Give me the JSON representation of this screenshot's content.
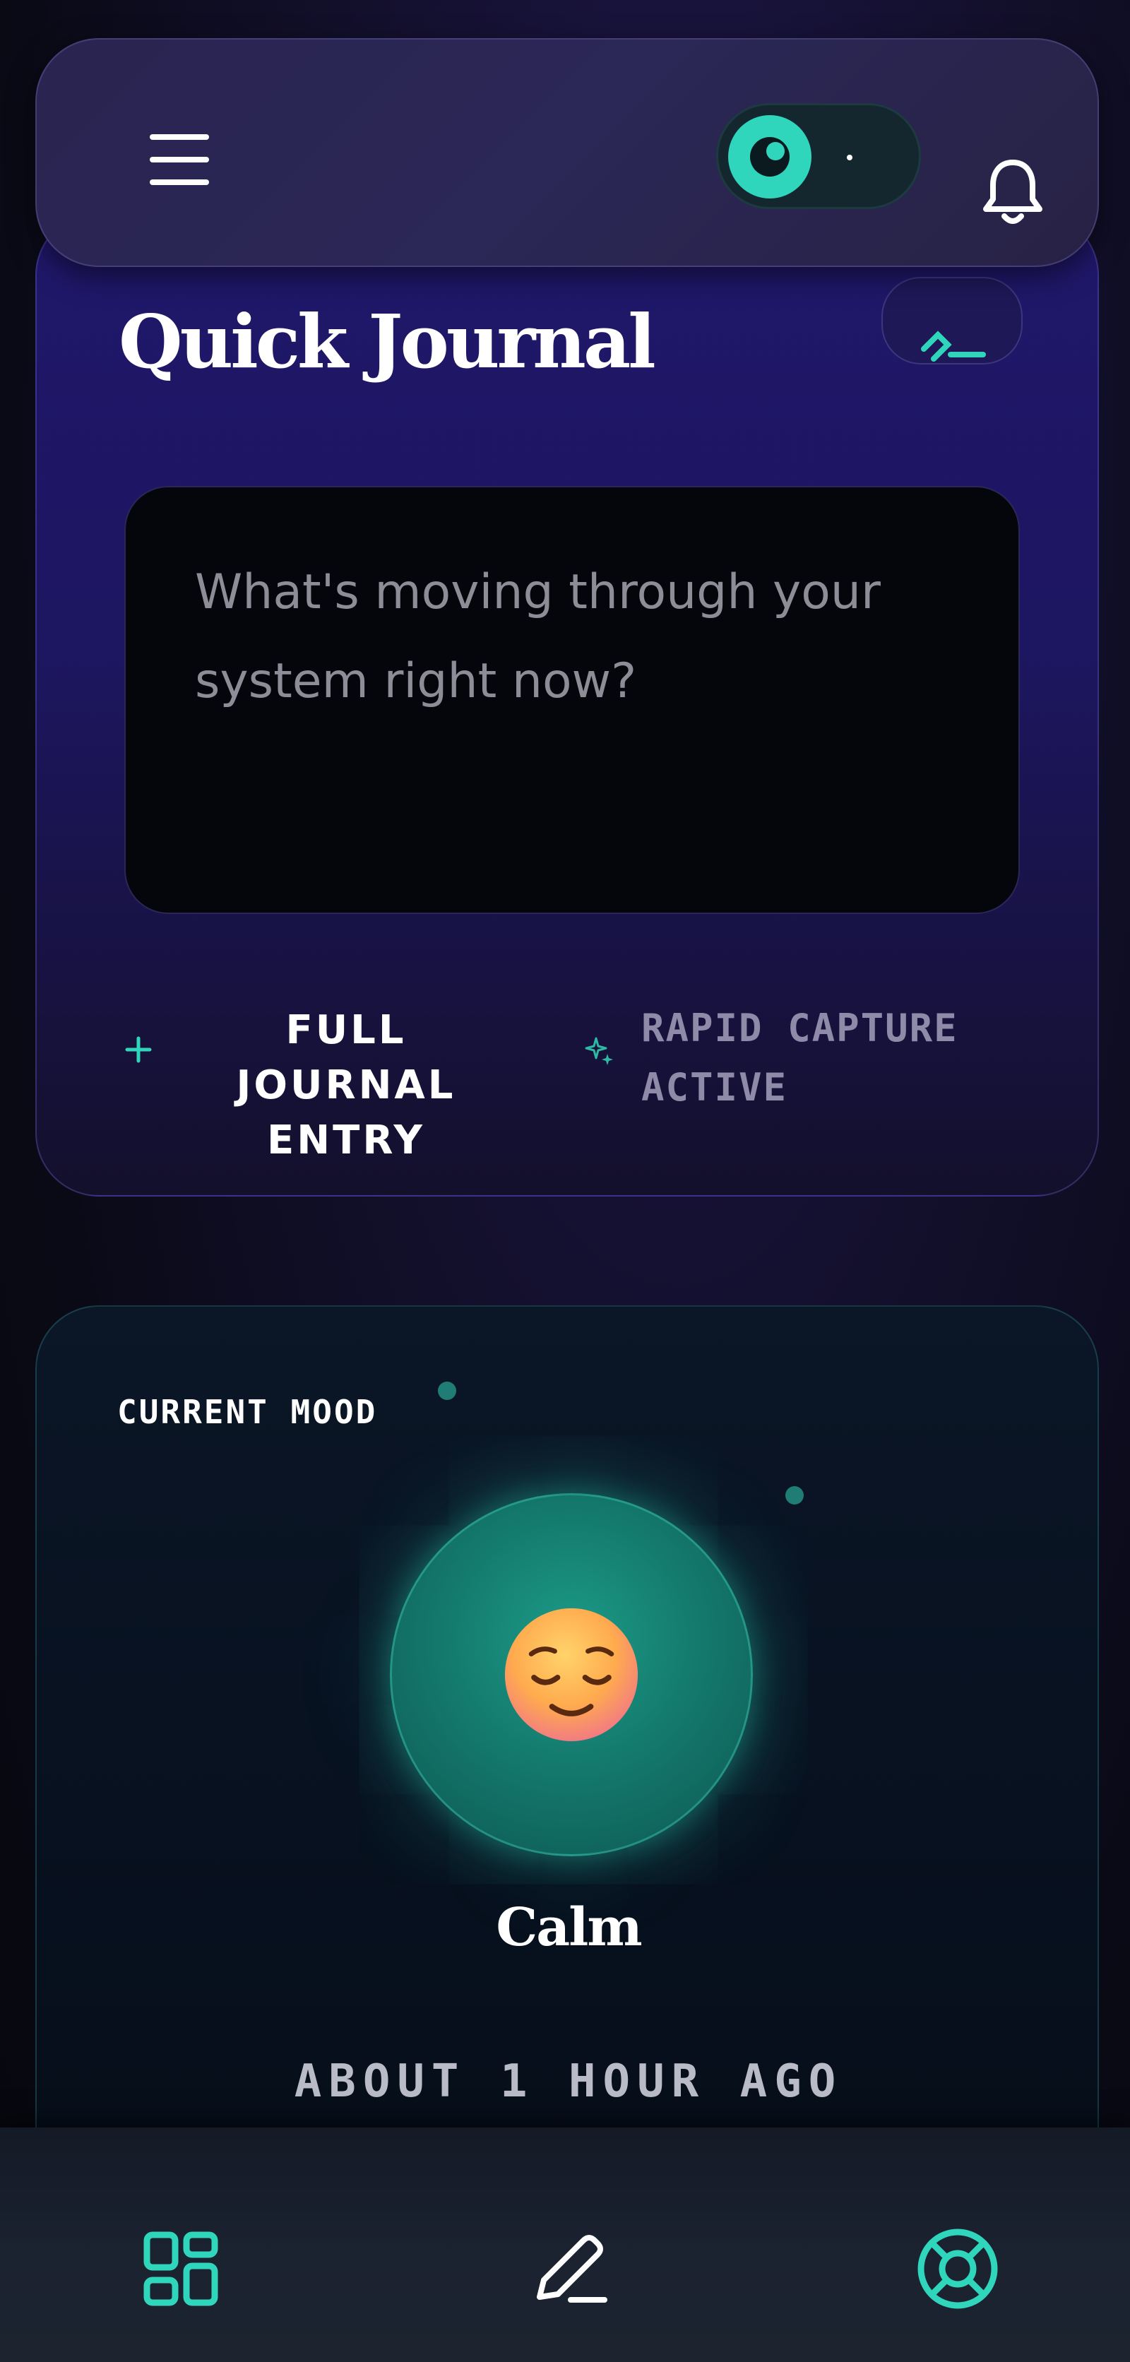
{
  "colors": {
    "accent": "#2fd6bb",
    "background": "#0a0a16",
    "journal_card": "#1d1660",
    "mood_card": "#081221"
  },
  "header": {
    "menu_icon": "hamburger-menu-icon",
    "theme_toggle_icon": "eye-icon",
    "notifications_icon": "bell-icon"
  },
  "journal": {
    "title": "Quick Journal",
    "edit_icon": "pencil-line-icon",
    "input_placeholder": "What's moving through your system right now?",
    "full_entry_icon": "plus-icon",
    "full_entry_label": "FULL JOURNAL ENTRY",
    "status_icon": "sparkle-icon",
    "status_label": "RAPID CAPTURE ACTIVE"
  },
  "mood": {
    "label": "CURRENT MOOD",
    "emoji": "relieved-face-emoji",
    "name": "Calm",
    "timestamp": "ABOUT 1 HOUR AGO"
  },
  "bottom_nav": {
    "items": [
      {
        "icon": "dashboard-grid-icon",
        "active": true
      },
      {
        "icon": "pencil-icon",
        "active": false
      },
      {
        "icon": "lifebuoy-icon",
        "active": false
      }
    ]
  }
}
